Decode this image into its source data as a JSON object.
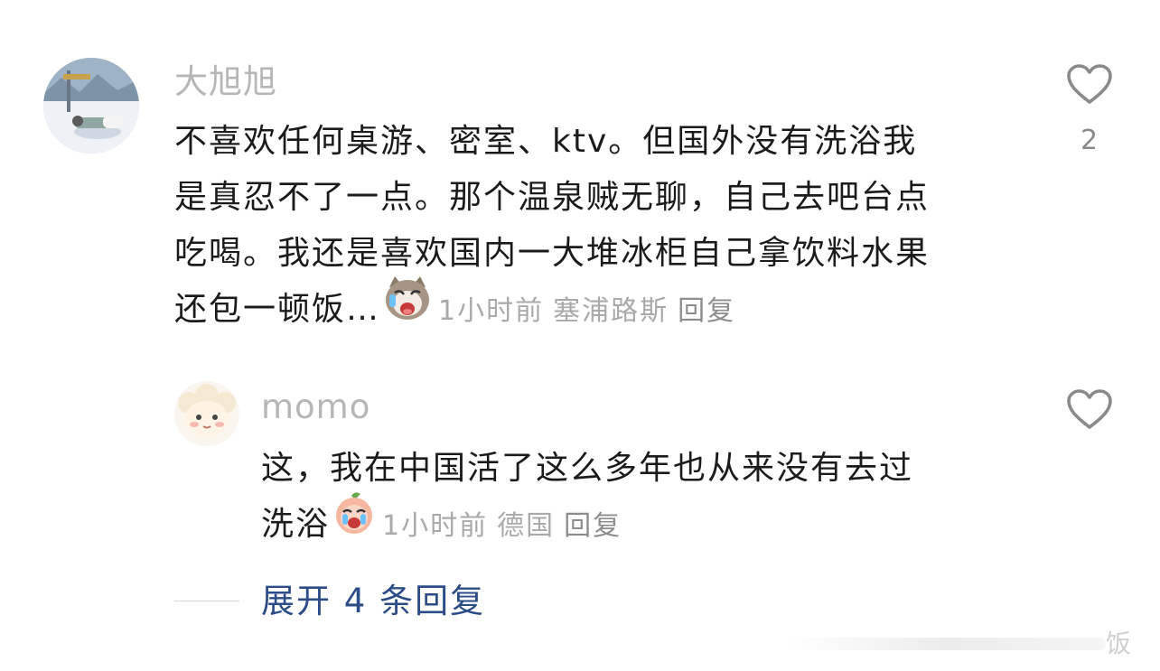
{
  "comments": [
    {
      "username": "大旭旭",
      "lines": [
        "不喜欢任何桌游、密室、ktv。但国外没有洗浴我",
        "是真忍不了一点。那个温泉贼无聊，自己去吧台点",
        "吃喝。我还是喜欢国内一大堆冰柜自己拿饮料水果",
        "还包一顿饭…"
      ],
      "time": "1小时前",
      "location": "塞浦路斯",
      "reply_label": "回复",
      "like_count": "2",
      "avatar_icon": "snow-photo-avatar",
      "emoji_icon": "crying-cat-emoji"
    },
    {
      "username": "momo",
      "lines": [
        "这，我在中国活了这么多年也从来没有去过",
        "洗浴"
      ],
      "time": "1小时前",
      "location": "德国",
      "reply_label": "回复",
      "avatar_icon": "cartoon-sheep-avatar",
      "emoji_icon": "crying-peach-emoji"
    }
  ],
  "expand_replies_label": "展开 4 条回复",
  "watermark_text": "饭",
  "colors": {
    "username": "#b6b6b6",
    "text": "#1b1b1b",
    "meta": "#a9a9a9",
    "expand_link": "#2b4c86",
    "like_outline": "#8a8a8a"
  }
}
